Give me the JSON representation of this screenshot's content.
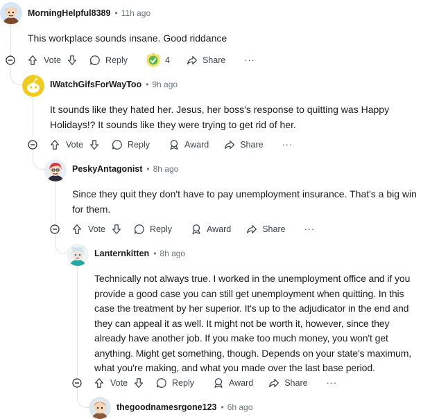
{
  "colors": {
    "line": "#dfe3e6",
    "meta": "#6b7479",
    "text": "#1c1c1c",
    "award_gold": "#f5c518",
    "award_green": "#58b947"
  },
  "comments": [
    {
      "username": "MorningHelpful8389",
      "time": "11h ago",
      "body": [
        "This workplace sounds insane. Good riddance"
      ],
      "actions": {
        "vote": "Vote",
        "reply": "Reply",
        "award_count": "4",
        "share": "Share",
        "more": "···"
      }
    },
    {
      "username": "IWatchGifsForWayToo",
      "time": "9h ago",
      "body": [
        "It sounds like they hated her. Jesus, her boss's response to quitting was Happy",
        "Holidays!? It sounds like they were trying to get rid of her."
      ],
      "actions": {
        "vote": "Vote",
        "reply": "Reply",
        "award": "Award",
        "share": "Share",
        "more": "···"
      }
    },
    {
      "username": "PeskyAntagonist",
      "time": "8h ago",
      "body": [
        "Since they quit they don't have to pay unemployment insurance. That's a big win",
        "for them."
      ],
      "actions": {
        "vote": "Vote",
        "reply": "Reply",
        "award": "Award",
        "share": "Share",
        "more": "···"
      }
    },
    {
      "username": "Lanternkitten",
      "time": "8h ago",
      "body": [
        "Technically not always true. I worked in the unemployment office and if you",
        "provide a good case you can still get unemployment when quitting. In this",
        "case the treatment by her superior. It's up to the adjudicator in the end and",
        "they can appeal it as well. It might not be worth it, however, since they",
        "already have another job. If you make too much money, you won't get",
        "anything. Might get something, though. Depends on your state's maximum,",
        "what you're making, and what you made over the last base period."
      ],
      "actions": {
        "vote": "Vote",
        "reply": "Reply",
        "award": "Award",
        "share": "Share",
        "more": "···"
      }
    },
    {
      "username": "thegoodnamesrgone123",
      "time": "6h ago"
    }
  ],
  "separator": "•"
}
